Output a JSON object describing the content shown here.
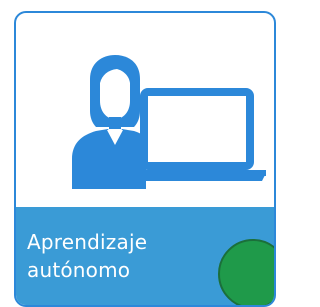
{
  "card": {
    "title_line1": "Aprendizaje",
    "title_line2": "autónomo",
    "icon": "person-with-laptop-icon",
    "status_indicator_color": "#1f9a4a",
    "accent_color": "#2c88d9",
    "caption_bg_color": "#3a9bd6"
  }
}
